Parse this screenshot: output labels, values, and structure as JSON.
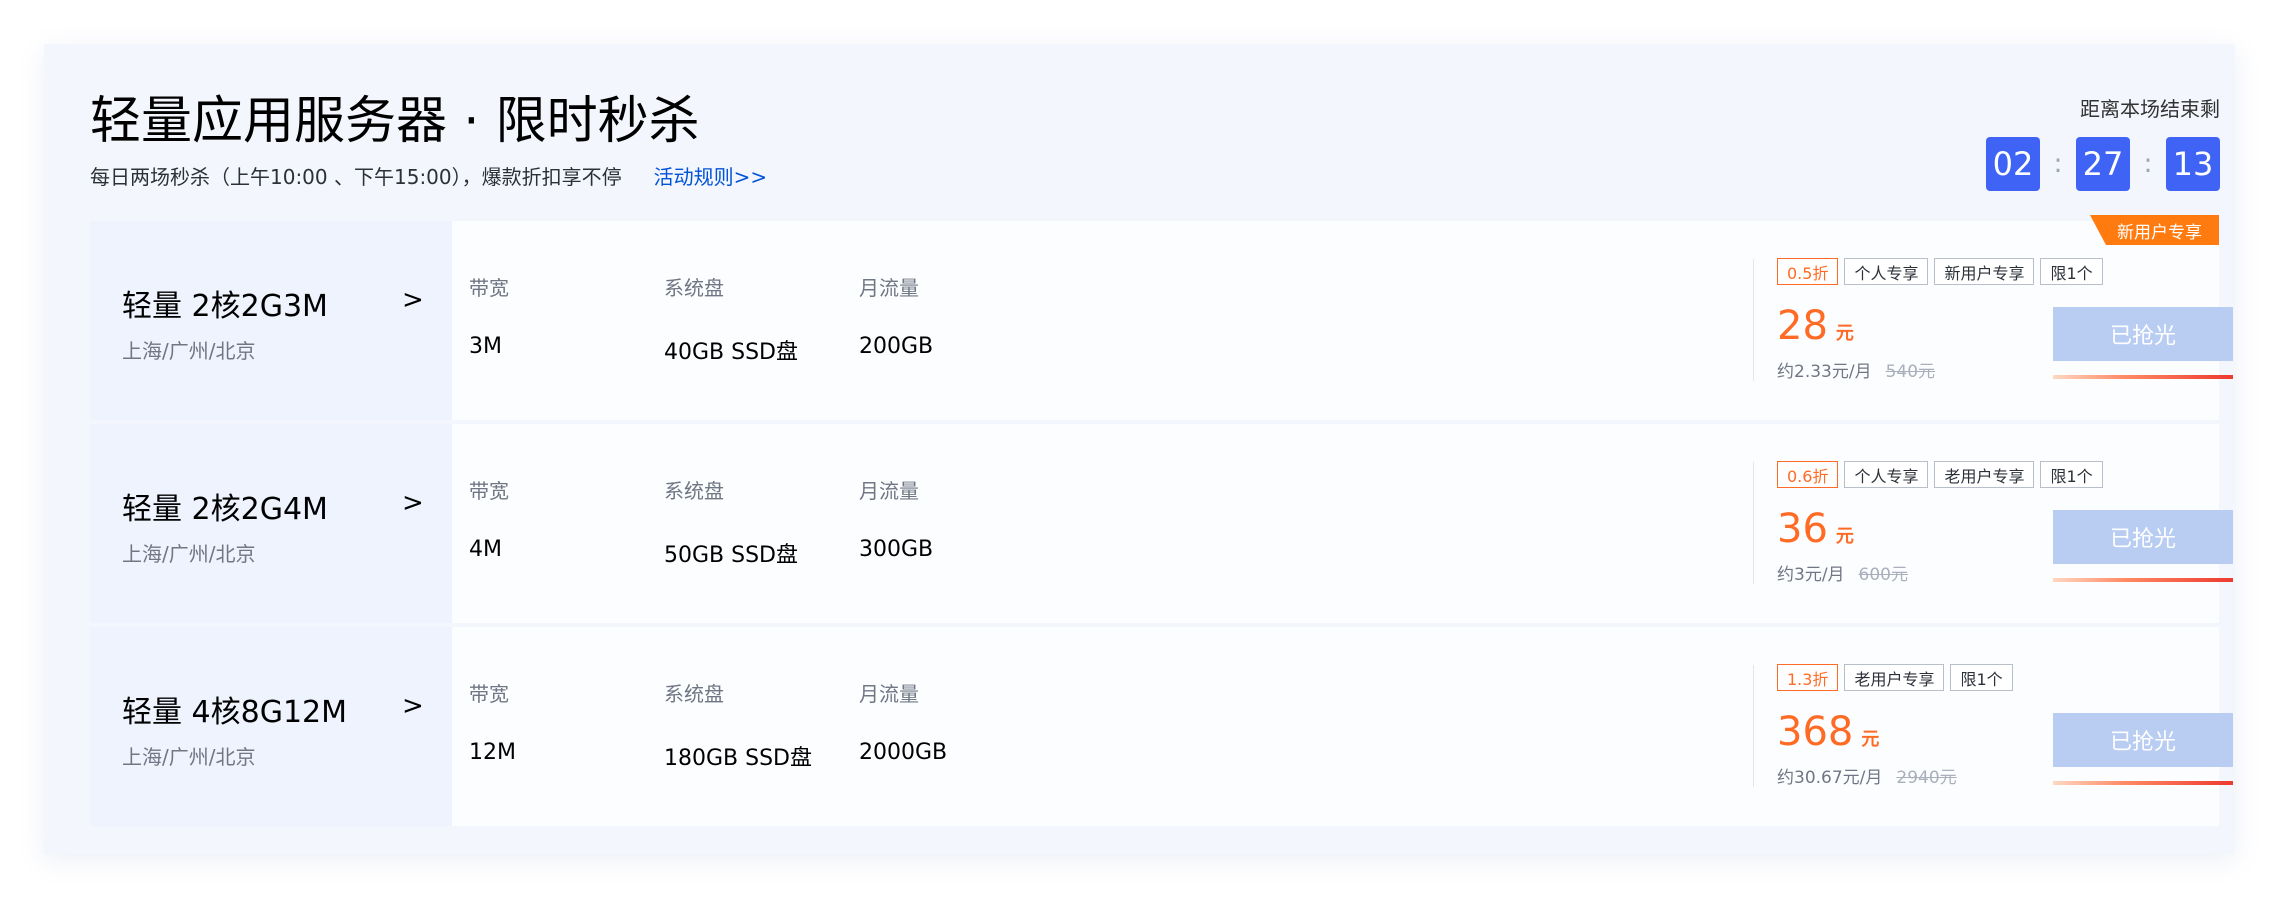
{
  "header": {
    "title": "轻量应用服务器 · 限时秒杀",
    "subtitle": "每日两场秒杀（上午10:00 、下午15:00），爆款折扣享不停",
    "rules_link": "活动规则>>"
  },
  "countdown": {
    "label": "距离本场结束剩",
    "hours": "02",
    "minutes": "27",
    "seconds": "13",
    "separator": ":"
  },
  "ribbon": "新用户专享",
  "colors": {
    "accent": "#3e63f5",
    "price": "#ff6b24",
    "ribbon": "#ff7a0f",
    "sold_out_button": "#b9cdf3"
  },
  "products": [
    {
      "name": "轻量 2核2G3M",
      "region": "上海/广州/北京",
      "chevron": ">",
      "specs": [
        {
          "label": "带宽",
          "value": "3M"
        },
        {
          "label": "系统盘",
          "value": "40GB SSD盘"
        },
        {
          "label": "月流量",
          "value": "200GB"
        }
      ],
      "tags": [
        "0.5折",
        "个人专享",
        "新用户专享",
        "限1个"
      ],
      "price": "28",
      "unit": "元",
      "monthly": "约2.33元/月",
      "original": "540元",
      "button": "已抢光"
    },
    {
      "name": "轻量 2核2G4M",
      "region": "上海/广州/北京",
      "chevron": ">",
      "specs": [
        {
          "label": "带宽",
          "value": "4M"
        },
        {
          "label": "系统盘",
          "value": "50GB SSD盘"
        },
        {
          "label": "月流量",
          "value": "300GB"
        }
      ],
      "tags": [
        "0.6折",
        "个人专享",
        "老用户专享",
        "限1个"
      ],
      "price": "36",
      "unit": "元",
      "monthly": "约3元/月",
      "original": "600元",
      "button": "已抢光"
    },
    {
      "name": "轻量 4核8G12M",
      "region": "上海/广州/北京",
      "chevron": ">",
      "specs": [
        {
          "label": "带宽",
          "value": "12M"
        },
        {
          "label": "系统盘",
          "value": "180GB SSD盘"
        },
        {
          "label": "月流量",
          "value": "2000GB"
        }
      ],
      "tags": [
        "1.3折",
        "老用户专享",
        "限1个"
      ],
      "price": "368",
      "unit": "元",
      "monthly": "约30.67元/月",
      "original": "2940元",
      "button": "已抢光"
    }
  ]
}
